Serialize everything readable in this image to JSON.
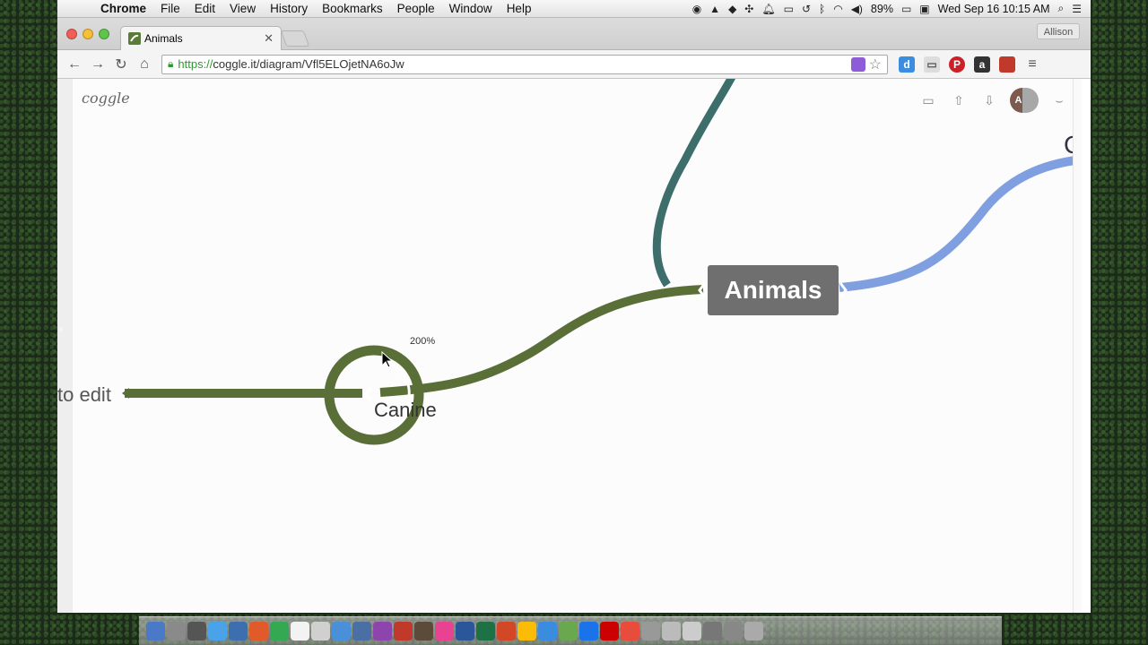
{
  "menubar": {
    "app": "Chrome",
    "menus": [
      "File",
      "Edit",
      "View",
      "History",
      "Bookmarks",
      "People",
      "Window",
      "Help"
    ],
    "battery": "89%",
    "datetime": "Wed Sep 16  10:15 AM"
  },
  "browser": {
    "tab_title": "Animals",
    "profile_name": "Allison",
    "url_scheme": "https://",
    "url_rest": "coggle.it/diagram/Vfl5ELOjetNA6oJw"
  },
  "page": {
    "logo": "coggle",
    "avatar_initials": "AM",
    "central_node": "Animals",
    "child_node": "Canine",
    "left_node_partial": "to edit",
    "right_node_partial": "C",
    "zoom_indicator": "200%",
    "branch_colors": {
      "green": "#5a6e38",
      "teal": "#3d6e6b",
      "blue": "#7f9fe0"
    }
  },
  "dock": {
    "icon_colors": [
      "#4a79c8",
      "#8a8a8a",
      "#555",
      "#4aa3e8",
      "#3d6fb0",
      "#e05a2a",
      "#34a853",
      "#f3f3f3",
      "#d0d0d0",
      "#4a90d9",
      "#4a6fa5",
      "#8e44ad",
      "#c0392b",
      "#5c4a3a",
      "#e84393",
      "#2b579a",
      "#1e7145",
      "#d24726",
      "#fbbc05",
      "#3a8dde",
      "#6aa84f",
      "#1a73e8",
      "#cc0000",
      "#e74c3c",
      "#999",
      "#bbb",
      "#ccc",
      "#777",
      "#888",
      "#aaa"
    ]
  }
}
